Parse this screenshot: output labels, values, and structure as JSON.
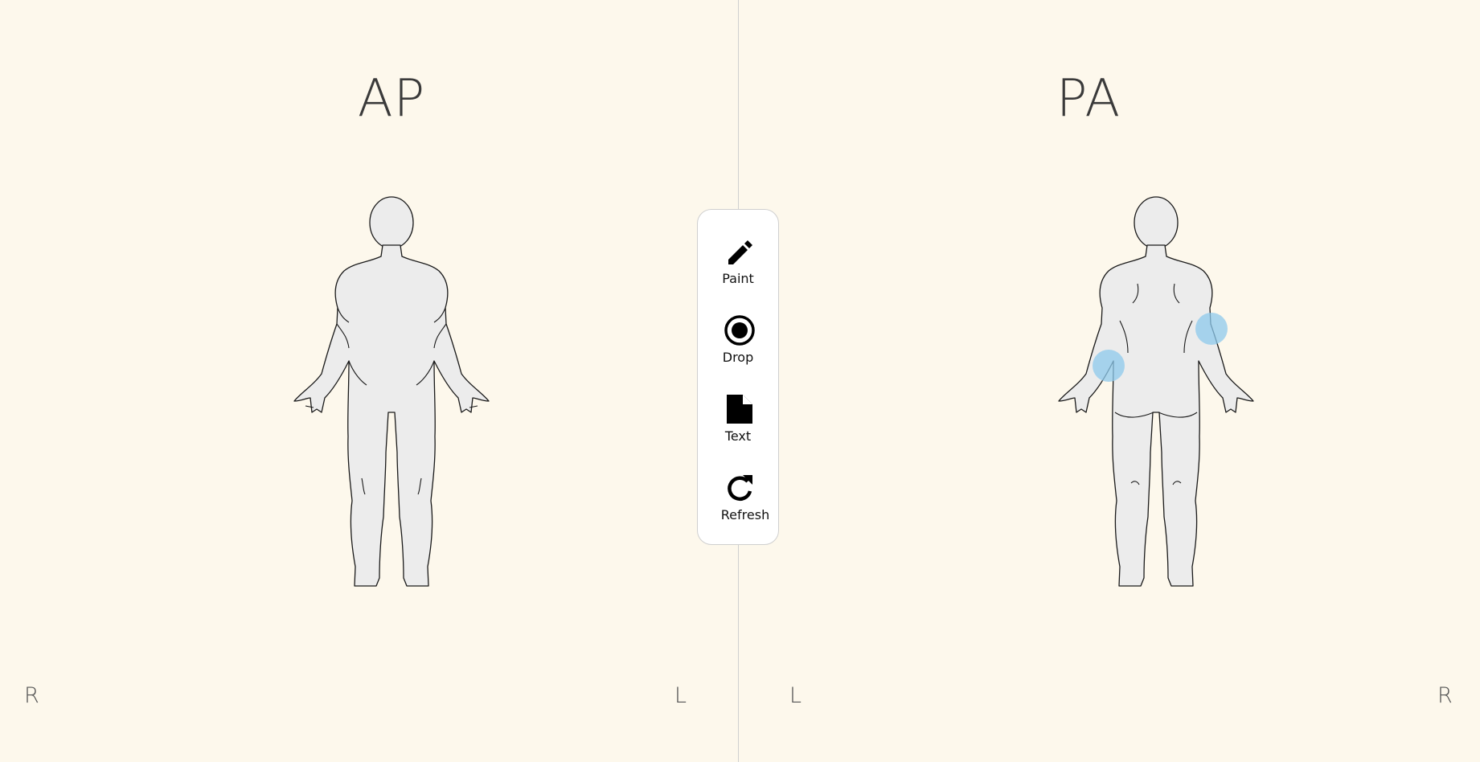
{
  "views": {
    "anterior": {
      "title": "AP",
      "left_label": "R",
      "right_label": "L"
    },
    "posterior": {
      "title": "PA",
      "left_label": "L",
      "right_label": "R"
    }
  },
  "toolbar": {
    "items": [
      {
        "label": "Paint",
        "icon": "pencil-icon"
      },
      {
        "label": "Drop",
        "icon": "radio-target-icon"
      },
      {
        "label": "Text",
        "icon": "document-icon"
      },
      {
        "label": "Refresh",
        "icon": "refresh-icon"
      }
    ]
  },
  "drop_marker_color": "#8ec9ec"
}
